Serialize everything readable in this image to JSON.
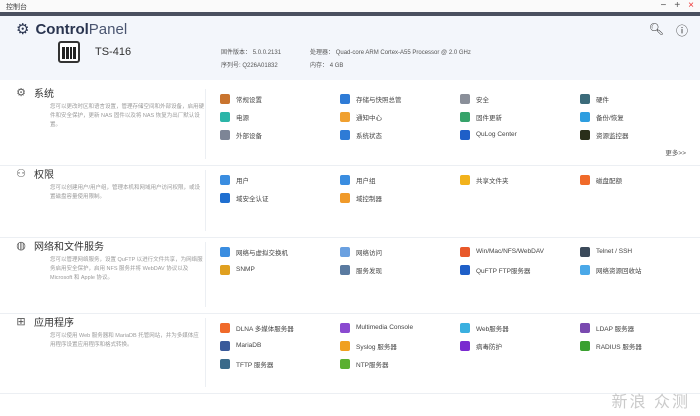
{
  "window": {
    "title": "控制台",
    "minimize": "−",
    "maximize": "+",
    "close": "×"
  },
  "header": {
    "app_name_bold": "Control",
    "app_name_light": "Panel",
    "model": "TS-416",
    "firmware_label": "固件版本：",
    "firmware": "5.0.0.2131",
    "serial_label": "序列号:",
    "serial": "Q226A01832",
    "cpu_label": "处理器：",
    "cpu": "Quad-core ARM Cortex-A55 Processor @ 2.0 GHz",
    "memory_label": "内存：",
    "memory": "4 GB"
  },
  "sections": [
    {
      "title": "系统",
      "icon": "gear-icon",
      "desc": "您可以更改时区和语言设置，管理存储空间和外部设备，启用硬件和安全保护，更新 NAS 固件以及将 NAS 恢复为出厂默认设置。",
      "items": [
        {
          "label": "常规设置",
          "color": "#c9742e"
        },
        {
          "label": "存储与快照总管",
          "color": "#2e7bd6"
        },
        {
          "label": "安全",
          "color": "#8a8f99"
        },
        {
          "label": "硬件",
          "color": "#3b6b7a"
        },
        {
          "label": "电源",
          "color": "#2bb5a8"
        },
        {
          "label": "通知中心",
          "color": "#f0a030"
        },
        {
          "label": "固件更新",
          "color": "#36a36a"
        },
        {
          "label": "备份/恢复",
          "color": "#2e9ee0"
        },
        {
          "label": "外部设备",
          "color": "#7d8596"
        },
        {
          "label": "系统状态",
          "color": "#2e7bd6"
        },
        {
          "label": "QuLog Center",
          "color": "#1f5fc8"
        },
        {
          "label": "资源监控器",
          "color": "#2a2f1a"
        }
      ],
      "more": "更多>>"
    },
    {
      "title": "权限",
      "icon": "user-icon",
      "desc": "您可以创建用户/用户组，管理本机和网域用户访问权限，或设置磁盘容量使用限制。",
      "items": [
        {
          "label": "用户",
          "color": "#3a8de0"
        },
        {
          "label": "用户组",
          "color": "#3a8de0"
        },
        {
          "label": "共享文件夹",
          "color": "#f2b21c"
        },
        {
          "label": "磁盘配额",
          "color": "#f06a2a"
        },
        {
          "label": "域安全认证",
          "color": "#1f6fd0"
        },
        {
          "label": "域控制器",
          "color": "#f09a2a"
        }
      ]
    },
    {
      "title": "网络和文件服务",
      "icon": "globe-icon",
      "desc": "您可以管理网络服务，设置 QuFTP 以进行文件共享，为网络服务启用安全保护，启用 NFS 服务并将 WebDAV 协议以及 Microsoft 和 Apple 协议。",
      "items": [
        {
          "label": "网络与虚拟交换机",
          "color": "#3a8de0"
        },
        {
          "label": "网络访问",
          "color": "#6aa0e0"
        },
        {
          "label": "Win/Mac/NFS/WebDAV",
          "color": "#e8582a"
        },
        {
          "label": "Telnet / SSH",
          "color": "#3b4a5a"
        },
        {
          "label": "SNMP",
          "color": "#e0a020"
        },
        {
          "label": "服务发现",
          "color": "#5a7aa0"
        },
        {
          "label": "QuFTP FTP服务器",
          "color": "#1f5fc8"
        },
        {
          "label": "网络资源回收站",
          "color": "#4aa8e8"
        }
      ]
    },
    {
      "title": "应用程序",
      "icon": "apps-icon",
      "desc": "您可以使用 Web 服务器和 MariaDB 托管网站，并为多媒体应用程序设置应用程序和格式转换。",
      "items": [
        {
          "label": "DLNA 多媒体服务器",
          "color": "#f06a2a"
        },
        {
          "label": "Multimedia Console",
          "color": "#8a4ad0"
        },
        {
          "label": "Web服务器",
          "color": "#3ab0e0"
        },
        {
          "label": "LDAP 服务器",
          "color": "#7a4ab0"
        },
        {
          "label": "MariaDB",
          "color": "#3a5a9a"
        },
        {
          "label": "Syslog 服务器",
          "color": "#f0a020"
        },
        {
          "label": "病毒防护",
          "color": "#7a2ad0"
        },
        {
          "label": "RADIUS 服务器",
          "color": "#3aa030"
        },
        {
          "label": "TFTP 服务器",
          "color": "#3a6a8a"
        },
        {
          "label": "NTP服务器",
          "color": "#5ab030"
        }
      ]
    }
  ],
  "watermark": "新浪 众测"
}
